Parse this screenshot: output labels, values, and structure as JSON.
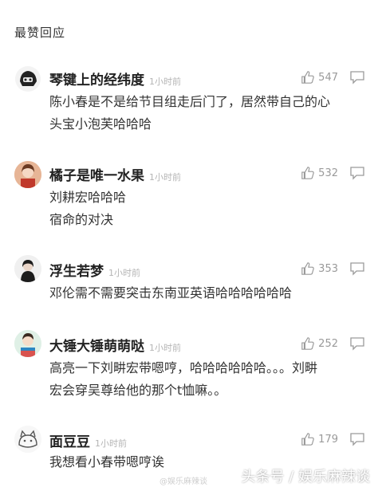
{
  "section": {
    "title": "最赞回应"
  },
  "comments": [
    {
      "name": "琴键上的经纬度",
      "time": "1小时前",
      "likes": "547",
      "lines": [
        "陈小春是不是给节目组走后门了，居然带自己的心",
        "头宝小泡芙哈哈哈"
      ]
    },
    {
      "name": "橘子是唯一水果",
      "time": "1小时前",
      "likes": "532",
      "lines": [
        "刘耕宏哈哈哈",
        "宿命的对决"
      ]
    },
    {
      "name": "浮生若梦",
      "time": "1小时前",
      "likes": "353",
      "lines": [
        "邓伦需不需要突击东南亚英语哈哈哈哈哈哈"
      ]
    },
    {
      "name": "大锤大锤萌萌哒",
      "time": "1小时前",
      "likes": "252",
      "lines": [
        "高亮一下刘畊宏带嗯哼，哈哈哈哈哈哈。。。刘畊",
        "宏会穿吴尊给他的那个t恤嘛。。"
      ]
    },
    {
      "name": "面豆豆",
      "time": "1小时前",
      "likes": "179",
      "lines": [
        "我想看小春带嗯哼诶"
      ]
    }
  ],
  "watermark": {
    "text": "头条号 / 娱乐麻辣谈",
    "weibo": "@娱乐麻辣谈"
  },
  "colors": {
    "muted": "#9a9a9a",
    "time": "#b5b5b5",
    "text": "#333333"
  }
}
